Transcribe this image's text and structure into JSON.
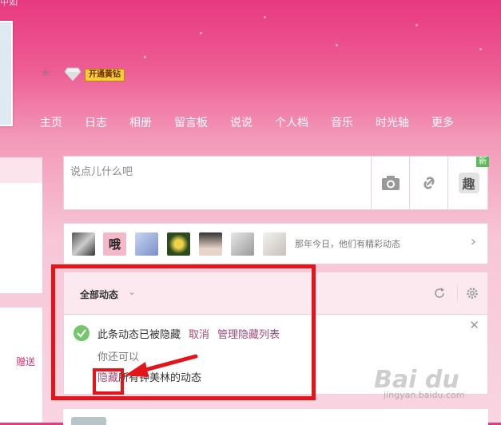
{
  "top_text": "中如",
  "vip_label": "开通黄钻",
  "nav": [
    "主页",
    "日志",
    "相册",
    "留言板",
    "说说",
    "个人档",
    "音乐",
    "时光轴",
    "更多"
  ],
  "left_gift": "赠送",
  "composer": {
    "placeholder": "说点儿什么吧",
    "new_badge": "新",
    "fun_label": "趣"
  },
  "memory": {
    "text": "那年今日，他们有精彩动态",
    "avatar_char": "哦"
  },
  "feed": {
    "filter_label": "全部动态",
    "hidden_msg": "此条动态已被隐藏",
    "cancel": "取消",
    "manage": "管理隐藏列表",
    "you_can": "你还可以",
    "hide_link": "隐藏",
    "hide_rest": "所有钟美林的动态"
  },
  "watermark": {
    "logo": "Bai du",
    "sub": "jingyan.baidu.com"
  },
  "colors": {
    "accent": "#e4141b",
    "link": "#a54b7a",
    "nav_bg": "#e8397f"
  }
}
